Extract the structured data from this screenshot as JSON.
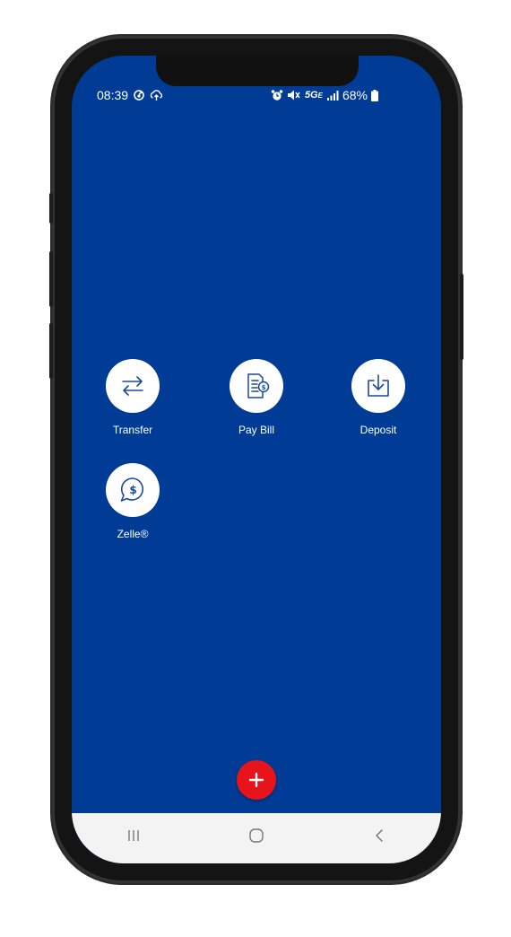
{
  "status_bar": {
    "time": "08:39",
    "network": "5G",
    "network_sub": "E",
    "battery": "68%"
  },
  "actions": [
    {
      "label": "Transfer",
      "icon": "transfer-arrows-icon"
    },
    {
      "label": "Pay Bill",
      "icon": "bill-dollar-icon"
    },
    {
      "label": "Deposit",
      "icon": "deposit-download-icon"
    },
    {
      "label": "Zelle®",
      "icon": "zelle-dollar-bubble-icon"
    }
  ],
  "fab": {
    "icon": "plus-icon"
  },
  "nav_bar": {
    "icons": [
      "recent-apps-icon",
      "home-icon",
      "back-icon"
    ]
  },
  "colors": {
    "background": "#003c96",
    "fab": "#e8141b",
    "icon_stroke": "#1b4a9c",
    "nav_bar": "#f3f3f3"
  }
}
